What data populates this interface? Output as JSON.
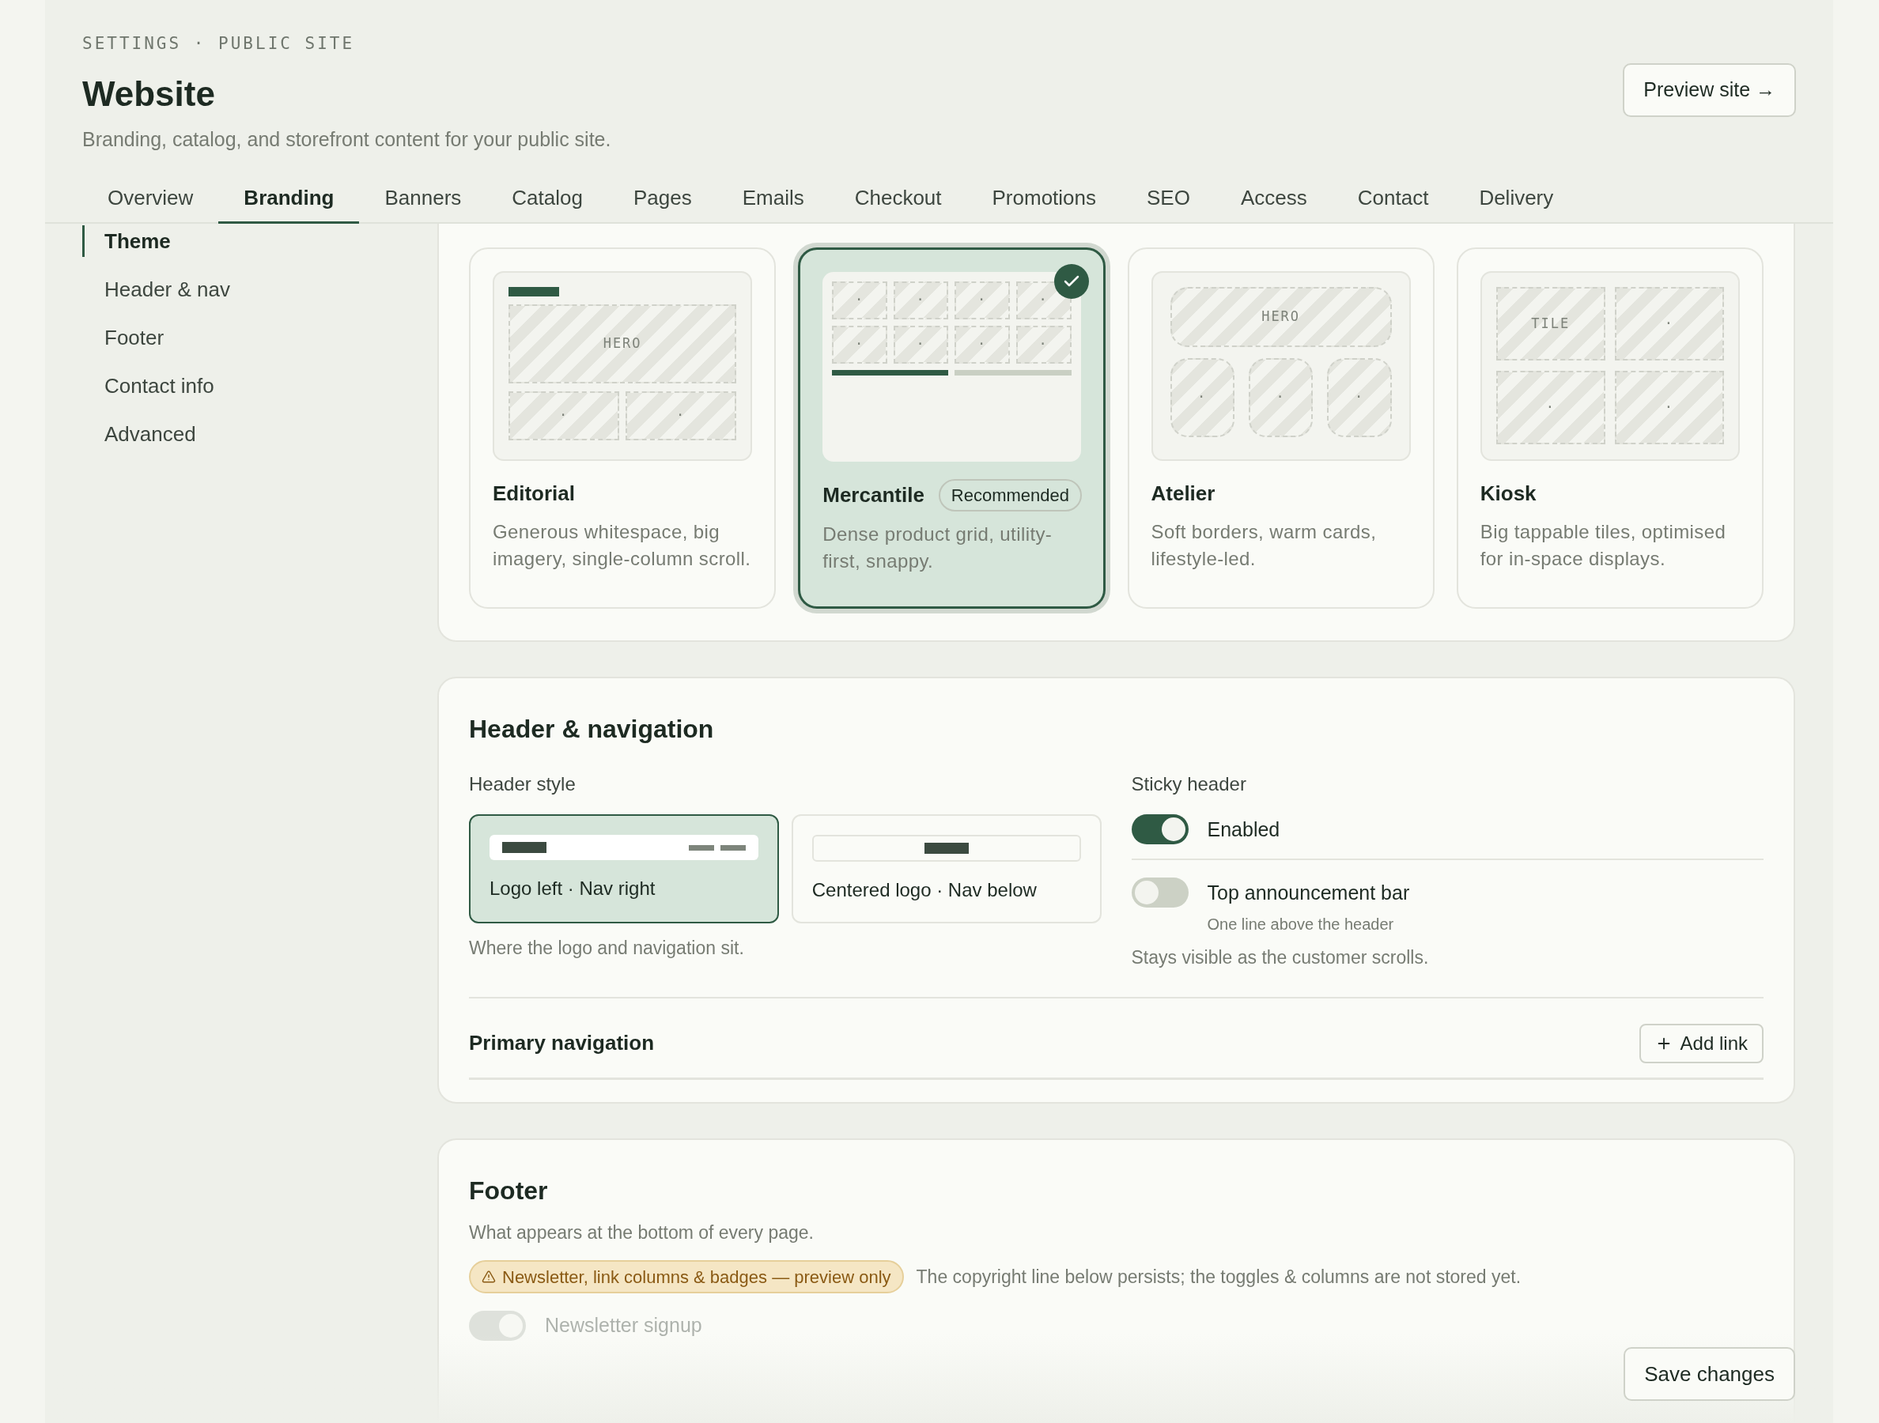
{
  "header": {
    "eyebrow": "SETTINGS · PUBLIC SITE",
    "title": "Website",
    "subtitle": "Branding, catalog, and storefront content for your public site.",
    "preview_button": "Preview site →"
  },
  "tabs": [
    {
      "label": "Overview",
      "selected": false
    },
    {
      "label": "Branding",
      "selected": true
    },
    {
      "label": "Banners",
      "selected": false
    },
    {
      "label": "Catalog",
      "selected": false
    },
    {
      "label": "Pages",
      "selected": false
    },
    {
      "label": "Emails",
      "selected": false
    },
    {
      "label": "Checkout",
      "selected": false
    },
    {
      "label": "Promotions",
      "selected": false
    },
    {
      "label": "SEO",
      "selected": false
    },
    {
      "label": "Access",
      "selected": false
    },
    {
      "label": "Contact",
      "selected": false
    },
    {
      "label": "Delivery",
      "selected": false
    }
  ],
  "sidebar": {
    "items": [
      {
        "label": "Theme",
        "selected": true
      },
      {
        "label": "Header & nav",
        "selected": false
      },
      {
        "label": "Footer",
        "selected": false
      },
      {
        "label": "Contact info",
        "selected": false
      },
      {
        "label": "Advanced",
        "selected": false
      }
    ]
  },
  "themes": [
    {
      "name": "Editorial",
      "description": "Generous whitespace, big imagery, single-column scroll.",
      "selected": false,
      "preview": {
        "kind": "editorial",
        "tiles": [
          "HERO",
          "·",
          "·"
        ]
      }
    },
    {
      "name": "Mercantile",
      "badge": "Recommended",
      "description": "Dense product grid, utility-first, snappy.",
      "selected": true,
      "preview": {
        "kind": "grid",
        "tiles": [
          "·",
          "·",
          "·",
          "·",
          "·",
          "·",
          "·",
          "·"
        ]
      }
    },
    {
      "name": "Atelier",
      "description": "Soft borders, warm cards, lifestyle-led.",
      "selected": false,
      "preview": {
        "kind": "soft",
        "tiles": [
          "HERO",
          "·",
          "·",
          "·"
        ]
      }
    },
    {
      "name": "Kiosk",
      "description": "Big tappable tiles, optimised for in-space displays.",
      "selected": false,
      "preview": {
        "kind": "tiles",
        "tiles": [
          "TILE",
          "·",
          "·",
          "·"
        ]
      }
    }
  ],
  "header_nav": {
    "title": "Header & navigation",
    "header_style": {
      "label": "Header style",
      "options": [
        {
          "label": "Logo left · Nav right",
          "kind": "left",
          "selected": true
        },
        {
          "label": "Centered logo · Nav below",
          "kind": "centered",
          "selected": false
        }
      ],
      "help": "Where the logo and navigation sit."
    },
    "sticky": {
      "label": "Sticky header",
      "toggles": [
        {
          "label": "Enabled",
          "on": true
        },
        {
          "label": "Top announcement bar",
          "hint": "One line above the header",
          "on": false
        }
      ],
      "help": "Stays visible as the customer scrolls."
    },
    "primary_nav": {
      "label": "Primary navigation",
      "add_button": "Add link"
    }
  },
  "footer": {
    "title": "Footer",
    "description": "What appears at the bottom of every page.",
    "warning": "Newsletter, link columns & badges — preview only",
    "note": "The copyright line below persists; the toggles & columns are not stored yet.",
    "toggles": [
      {
        "label": "Newsletter signup",
        "on": true
      }
    ]
  },
  "save_button": "Save changes"
}
